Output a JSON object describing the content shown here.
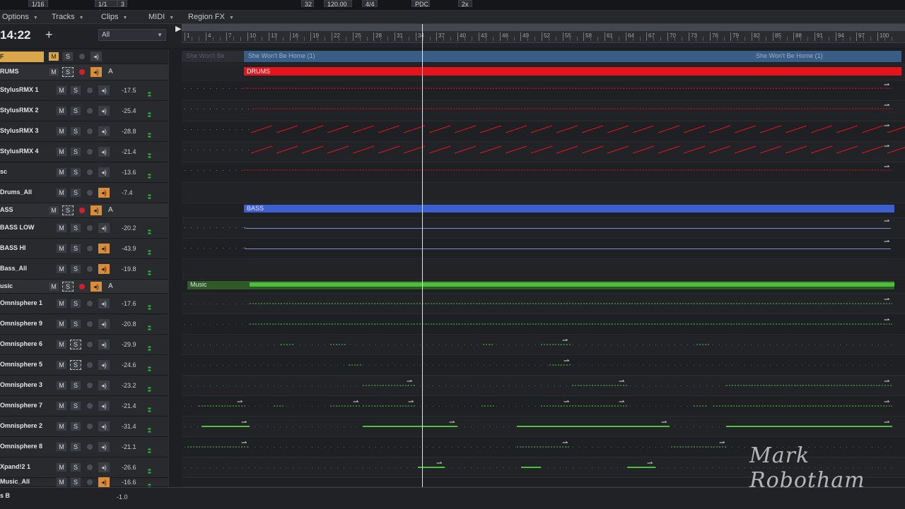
{
  "top_strip": [
    "1/16",
    "1/1 ♩",
    "3",
    "32",
    "120.00",
    "4/4",
    "PDC",
    "2x"
  ],
  "menu": [
    "Options",
    "Tracks",
    "Clips",
    "MIDI",
    "Region FX"
  ],
  "time": "14:22",
  "track_filter": "All",
  "ruler_labels": [
    "1",
    "4",
    "7",
    "10",
    "13",
    "16",
    "19",
    "22",
    "25",
    "28",
    "31",
    "34",
    "37",
    "40",
    "43",
    "46",
    "49",
    "52",
    "55",
    "58",
    "61",
    "64",
    "67",
    "70",
    "73",
    "76",
    "79",
    "82",
    "85",
    "88",
    "91",
    "94",
    "97",
    "100"
  ],
  "tracks": [
    {
      "name": "F",
      "type": "top",
      "vol": ""
    },
    {
      "name": "RUMS",
      "type": "folder",
      "vol": ""
    },
    {
      "name": "StylusRMX 1",
      "type": "child",
      "vol": "-17.5"
    },
    {
      "name": "StylusRMX 2",
      "type": "child",
      "vol": "-25.4"
    },
    {
      "name": "StylusRMX 3",
      "type": "child",
      "vol": "-28.8"
    },
    {
      "name": "StylusRMX 4",
      "type": "child",
      "vol": "-21.4"
    },
    {
      "name": "sc",
      "type": "child",
      "vol": "-13.6"
    },
    {
      "name": "Drums_All",
      "type": "child",
      "vol": "-7.4"
    },
    {
      "name": "ASS",
      "type": "folder",
      "vol": ""
    },
    {
      "name": "BASS LOW",
      "type": "child",
      "vol": "-20.2"
    },
    {
      "name": "BASS HI",
      "type": "child",
      "vol": "-43.9"
    },
    {
      "name": "Bass_All",
      "type": "child",
      "vol": "-19.8"
    },
    {
      "name": "usic",
      "type": "folder",
      "vol": ""
    },
    {
      "name": "Omnisphere 1",
      "type": "child",
      "vol": "-17.6"
    },
    {
      "name": "Omnisphere 9",
      "type": "child",
      "vol": "-20.8"
    },
    {
      "name": "Omnisphere 6",
      "type": "child",
      "vol": "-29.9"
    },
    {
      "name": "Omnisphere 5",
      "type": "child",
      "vol": "-24.6"
    },
    {
      "name": "Omnisphere 3",
      "type": "child",
      "vol": "-23.2"
    },
    {
      "name": "Omnisphere 7",
      "type": "child",
      "vol": "-21.4"
    },
    {
      "name": "Omnisphere 2",
      "type": "child",
      "vol": "-31.4"
    },
    {
      "name": "Omnisphere 8",
      "type": "child",
      "vol": "-21.1"
    },
    {
      "name": "Xpand!2 1",
      "type": "child",
      "vol": "-26.6"
    },
    {
      "name": "Music_All",
      "type": "child",
      "vol": "-16.6"
    }
  ],
  "labels": {
    "arrangement_clip_top": "She Won't Be Home (1)",
    "arrangement_clip_top_ghost": "She Won't Be",
    "arrangement_clip_top_right": "She Won't Be Home (1)",
    "drums_clip": "DRUMS",
    "bass_clip": "BASS",
    "music_clip": "Music"
  },
  "master": {
    "name": "s B",
    "vol": "-1.0"
  },
  "watermark": "Mark Robotham",
  "colors": {
    "drums": "#e3141b",
    "bass": "#3d5fd0",
    "music": "#4cc03a",
    "top_clip": "#3a5d86"
  }
}
